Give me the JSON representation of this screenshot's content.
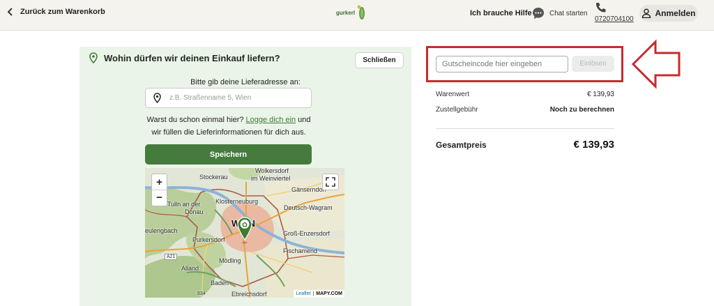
{
  "header": {
    "back_label": "Zurück zum Warenkorb",
    "logo_text": "gurkerl",
    "help_label": "Ich brauche Hilfe",
    "chat_label": "Chat starten",
    "phone_number": "0720704100",
    "login_label": "Anmelden"
  },
  "delivery": {
    "title": "Wohin dürfen wir deinen Einkauf liefern?",
    "close_label": "Schließen",
    "address_label": "Bitte gib deine Lieferadresse an:",
    "address_placeholder": "z.B. Straßenname 5, Wien",
    "login_prompt_before": "Warst du schon einmal hier? ",
    "login_link": "Logge dich ein",
    "login_prompt_after": " und wir füllen die Lieferinformationen für dich aus.",
    "save_label": "Speichern"
  },
  "map": {
    "zoom_in": "+",
    "zoom_out": "−",
    "labels": {
      "wolkersdorf": "Wolkersdorf",
      "weinviertel": "im Weinviertel",
      "stockerau": "Stockerau",
      "gaenserndorf": "Gänserndorf",
      "klosterneuburg": "Klosterneuburg",
      "deutsch_wagram": "Deutsch-Wagram",
      "tulln": "Tulln an der",
      "donau": "Donau",
      "neulengbach": "eulengbach",
      "wien": "WIEN",
      "gross_enzersdorf": "Groß-Enzersdorf",
      "purkersdorf": "Purkersdorf",
      "fischamend": "Fischamend",
      "a21": "A21",
      "moedling": "Mödling",
      "alland": "Alland",
      "baden": "Baden",
      "ebreichsdorf": "Ebreichsdorf",
      "r834": "834"
    },
    "attribution_leaflet": "Leaflet",
    "attribution_sep": "|",
    "attribution_mapy": "MAPY.COM"
  },
  "summary": {
    "voucher_placeholder": "Gutscheincode hier eingeben",
    "redeem_label": "Einlösen",
    "goods_label": "Warenwert",
    "goods_value": "€ 139,93",
    "delivery_fee_label": "Zustellgebühr",
    "delivery_fee_value": "Noch zu berechnen",
    "total_label": "Gesamtpreis",
    "total_value": "€ 139,93"
  },
  "colors": {
    "primary_green": "#457c3d",
    "highlight_red": "#c62b2f",
    "panel_green": "#eaf4e8"
  }
}
